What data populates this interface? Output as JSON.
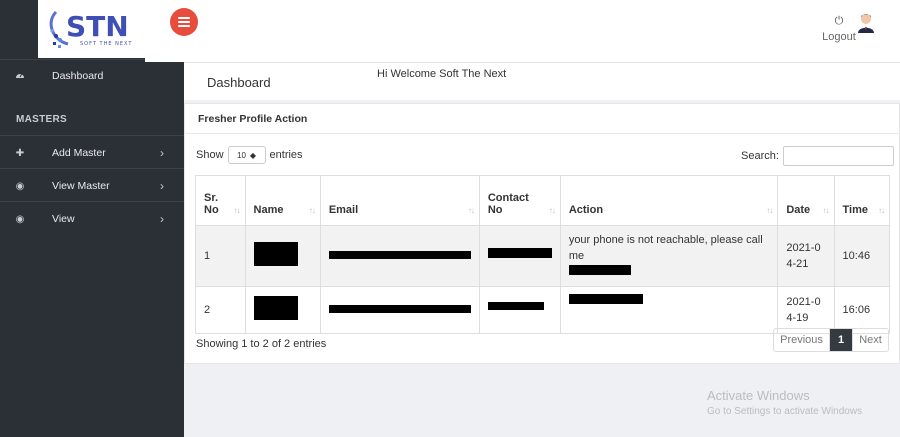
{
  "logo": {
    "text": "STN",
    "tagline": "SOFT THE NEXT"
  },
  "sidebar": {
    "items": [
      {
        "label": "Dashboard",
        "icon": "tachometer-icon"
      },
      {
        "label": "Add Master",
        "icon": "plus-icon"
      },
      {
        "label": "View Master",
        "icon": "eye-icon"
      },
      {
        "label": "View",
        "icon": "eye-icon"
      }
    ],
    "section_heading": "MASTERS"
  },
  "topbar": {
    "logout_label": "Logout"
  },
  "page": {
    "title": "Dashboard",
    "welcome": "Hi Welcome Soft The Next"
  },
  "card": {
    "title": "Fresher Profile Action",
    "show_label": "Show",
    "entries_label": "entries",
    "page_length": "10",
    "search_label": "Search:",
    "search_value": "",
    "columns": [
      "Sr. No",
      "Name",
      "Email",
      "Contact No",
      "Action",
      "Date",
      "Time"
    ],
    "rows": [
      {
        "sr": "1",
        "action": "your phone is not reachable, please call me",
        "date": "2021-04-21",
        "time": "10:46"
      },
      {
        "sr": "2",
        "action": "",
        "date": "2021-04-19",
        "time": "16:06"
      }
    ],
    "info": "Showing 1 to 2 of 2 entries",
    "pager": {
      "prev": "Previous",
      "current": "1",
      "next": "Next"
    }
  },
  "watermark": {
    "title": "Activate Windows",
    "subtitle": "Go to Settings to activate Windows"
  },
  "colors": {
    "sidebar_bg": "#2b2f36",
    "toggle": "#e74c3c",
    "pager_active": "#343a40"
  }
}
